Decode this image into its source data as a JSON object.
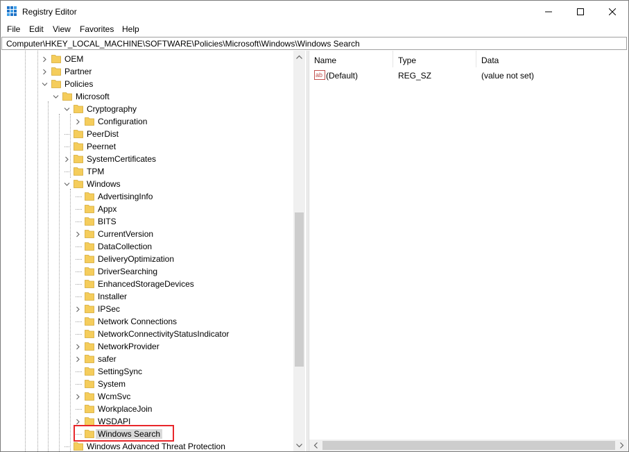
{
  "window": {
    "title": "Registry Editor"
  },
  "menu": {
    "file": "File",
    "edit": "Edit",
    "view": "View",
    "favorites": "Favorites",
    "help": "Help"
  },
  "address": {
    "path": "Computer\\HKEY_LOCAL_MACHINE\\SOFTWARE\\Policies\\Microsoft\\Windows\\Windows Search"
  },
  "tree": {
    "items": [
      {
        "label": "OEM",
        "expander": "collapsed"
      },
      {
        "label": "Partner",
        "expander": "collapsed"
      },
      {
        "label": "Policies",
        "expander": "expanded"
      },
      {
        "label": "Microsoft",
        "expander": "expanded"
      },
      {
        "label": "Cryptography",
        "expander": "expanded"
      },
      {
        "label": "Configuration",
        "expander": "collapsed"
      },
      {
        "label": "PeerDist",
        "expander": "none"
      },
      {
        "label": "Peernet",
        "expander": "none"
      },
      {
        "label": "SystemCertificates",
        "expander": "collapsed"
      },
      {
        "label": "TPM",
        "expander": "none"
      },
      {
        "label": "Windows",
        "expander": "expanded"
      },
      {
        "label": "AdvertisingInfo",
        "expander": "none"
      },
      {
        "label": "Appx",
        "expander": "none"
      },
      {
        "label": "BITS",
        "expander": "none"
      },
      {
        "label": "CurrentVersion",
        "expander": "collapsed"
      },
      {
        "label": "DataCollection",
        "expander": "none"
      },
      {
        "label": "DeliveryOptimization",
        "expander": "none"
      },
      {
        "label": "DriverSearching",
        "expander": "none"
      },
      {
        "label": "EnhancedStorageDevices",
        "expander": "none"
      },
      {
        "label": "Installer",
        "expander": "none"
      },
      {
        "label": "IPSec",
        "expander": "collapsed"
      },
      {
        "label": "Network Connections",
        "expander": "none"
      },
      {
        "label": "NetworkConnectivityStatusIndicator",
        "expander": "none"
      },
      {
        "label": "NetworkProvider",
        "expander": "collapsed"
      },
      {
        "label": "safer",
        "expander": "collapsed"
      },
      {
        "label": "SettingSync",
        "expander": "none"
      },
      {
        "label": "System",
        "expander": "none"
      },
      {
        "label": "WcmSvc",
        "expander": "collapsed"
      },
      {
        "label": "WorkplaceJoin",
        "expander": "none"
      },
      {
        "label": "WSDAPI",
        "expander": "collapsed"
      },
      {
        "label": "Windows Search",
        "expander": "none",
        "selected": true
      },
      {
        "label": "Windows Advanced Threat Protection",
        "expander": "none"
      }
    ]
  },
  "list": {
    "columns": {
      "name": "Name",
      "type": "Type",
      "data": "Data"
    },
    "rows": [
      {
        "name": "(Default)",
        "type": "REG_SZ",
        "data": "(value not set)",
        "icon": "string-value-icon"
      }
    ]
  },
  "colors": {
    "highlight_border": "#e8262a",
    "folder": "#f5cd5c",
    "selection": "#d9d9d9"
  }
}
